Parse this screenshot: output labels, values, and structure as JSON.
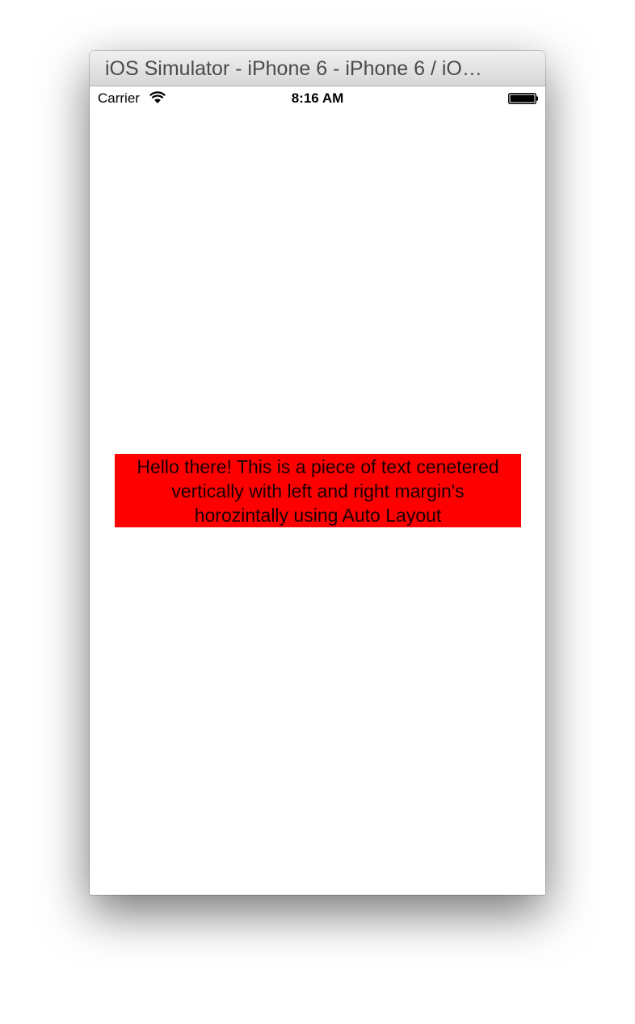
{
  "window": {
    "title": "iOS Simulator - iPhone 6 - iPhone 6 / iO…"
  },
  "statusbar": {
    "carrier": "Carrier",
    "time": "8:16 AM",
    "wifi_icon": "wifi-icon",
    "battery_icon": "battery-icon"
  },
  "content": {
    "label": "Hello there! This is a piece of text cenetered vertically with left and right margin's horozintally using Auto Layout",
    "label_background": "#ff0000"
  }
}
